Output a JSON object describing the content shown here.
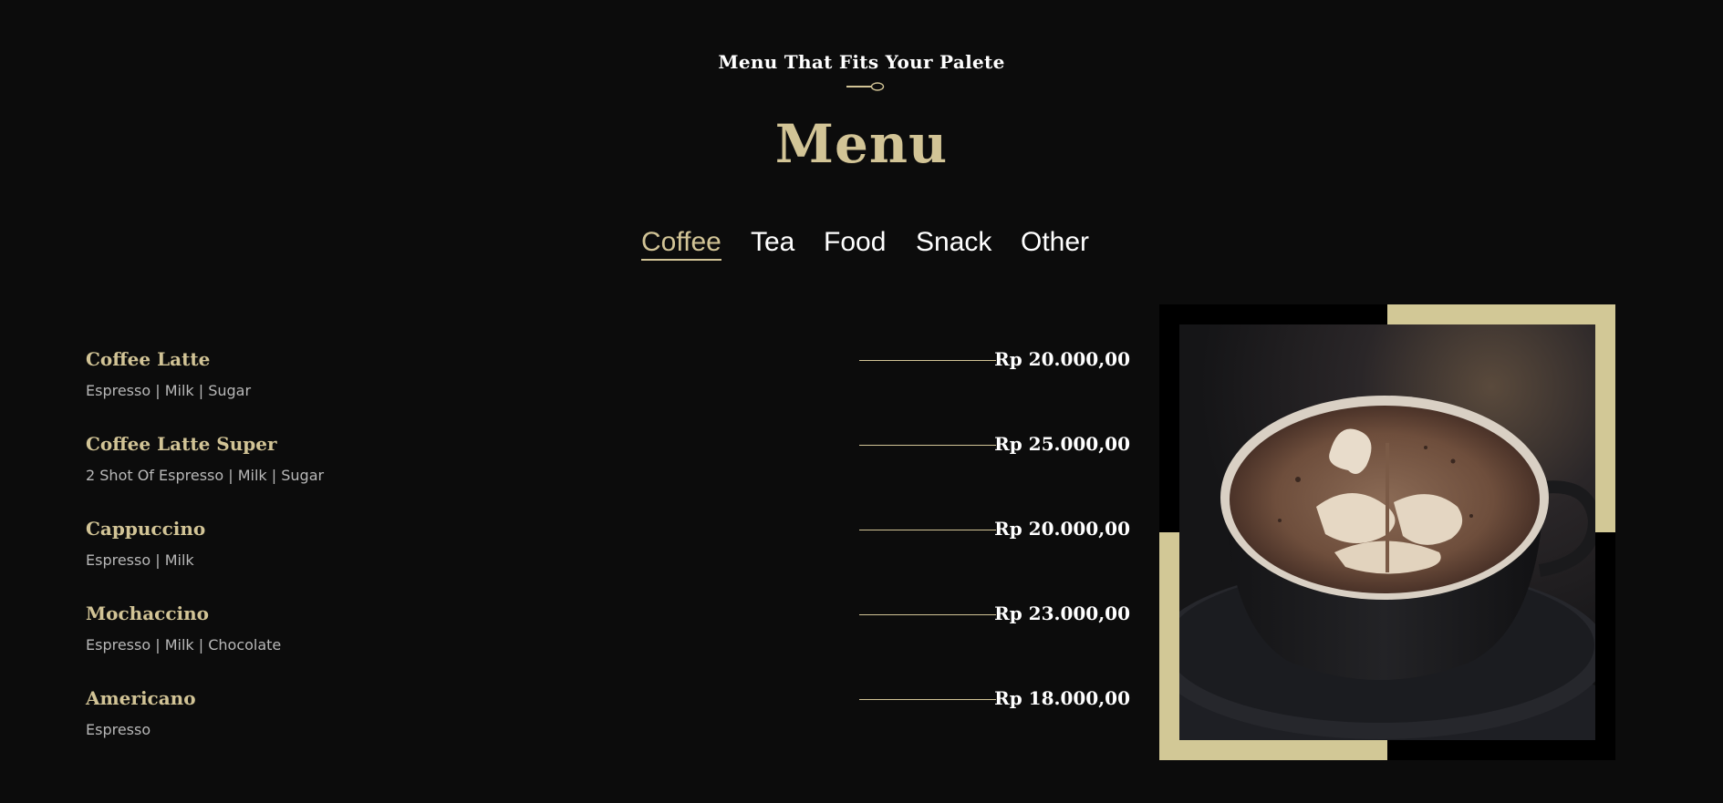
{
  "header": {
    "subtitle": "Menu That Fits Your Palete",
    "title": "Menu",
    "divider_icon": "spoon-icon"
  },
  "tabs": [
    {
      "label": "Coffee",
      "active": true
    },
    {
      "label": "Tea",
      "active": false
    },
    {
      "label": "Food",
      "active": false
    },
    {
      "label": "Snack",
      "active": false
    },
    {
      "label": "Other",
      "active": false
    }
  ],
  "menu_items": [
    {
      "name": "Coffee Latte",
      "description": "Espresso | Milk | Sugar",
      "price": "Rp 20.000,00"
    },
    {
      "name": "Coffee Latte Super",
      "description": "2 Shot Of Espresso | Milk | Sugar",
      "price": "Rp 25.000,00"
    },
    {
      "name": "Cappuccino",
      "description": "Espresso | Milk",
      "price": "Rp 20.000,00"
    },
    {
      "name": "Mochaccino",
      "description": "Espresso | Milk | Chocolate",
      "price": "Rp 23.000,00"
    },
    {
      "name": "Americano",
      "description": "Espresso",
      "price": "Rp 18.000,00"
    }
  ],
  "colors": {
    "background": "#0c0c0c",
    "accent": "#d2c496",
    "text": "#ffffff",
    "muted": "#b8b8b8"
  }
}
